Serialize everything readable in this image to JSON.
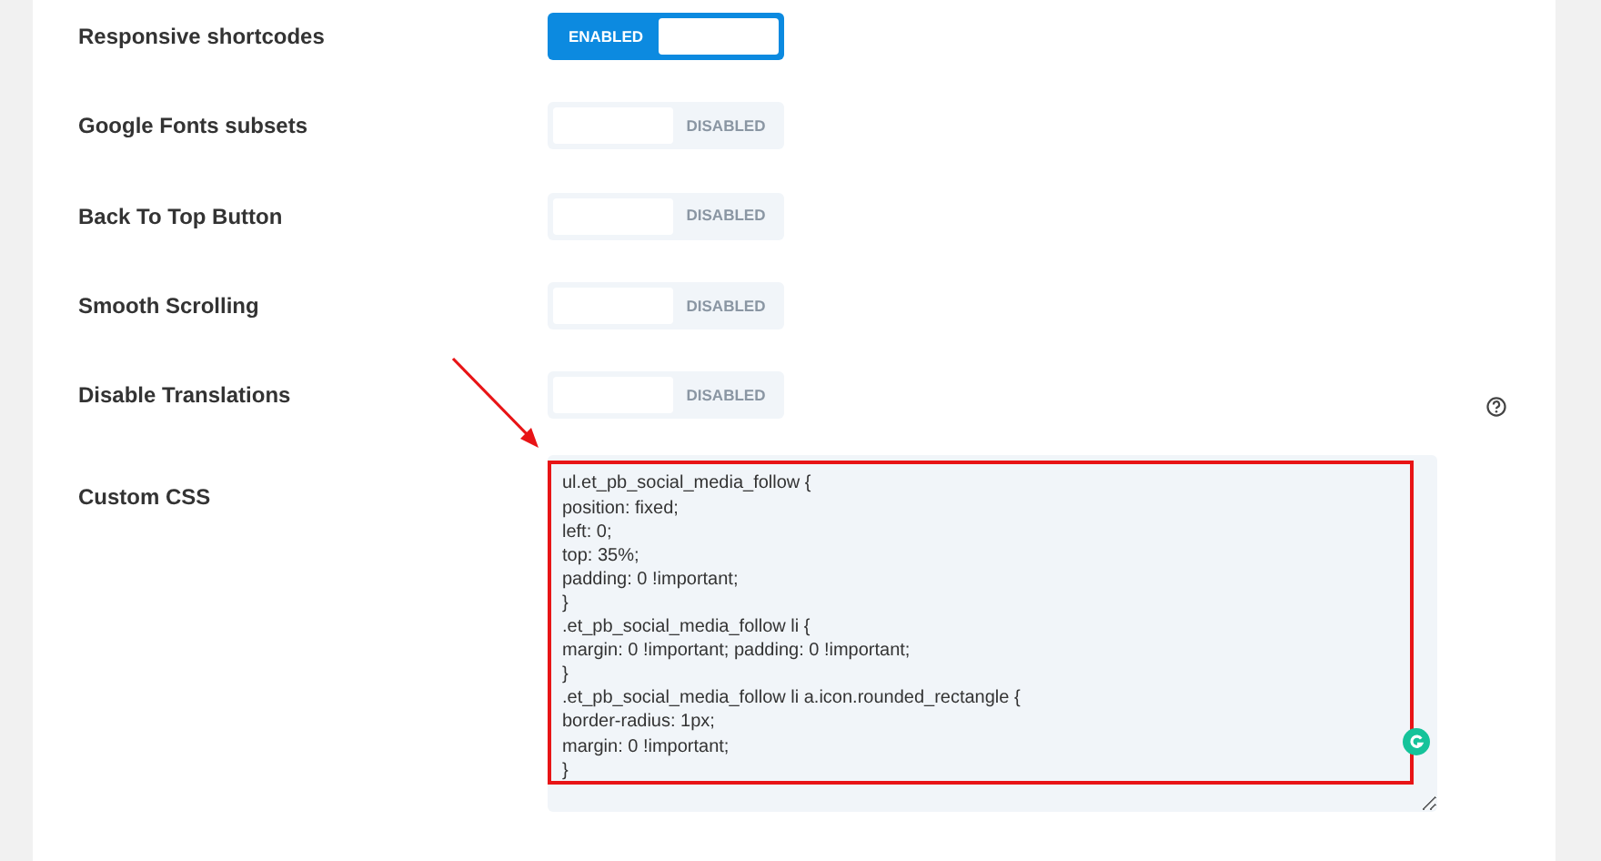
{
  "settings": [
    {
      "kind": "toggle",
      "label": "Responsive shortcodes",
      "on": true,
      "state_label": "ENABLED"
    },
    {
      "kind": "toggle",
      "label": "Google Fonts subsets",
      "on": false,
      "state_label": "DISABLED"
    },
    {
      "kind": "toggle",
      "label": "Back To Top Button",
      "on": false,
      "state_label": "DISABLED"
    },
    {
      "kind": "toggle",
      "label": "Smooth Scrolling",
      "on": false,
      "state_label": "DISABLED"
    },
    {
      "kind": "toggle",
      "label": "Disable Translations",
      "on": false,
      "state_label": "DISABLED",
      "help": true
    },
    {
      "kind": "code",
      "label": "Custom CSS",
      "value": "ul.et_pb_social_media_follow {\nposition: fixed;\nleft: 0;\ntop: 35%;\npadding: 0 !important;\n}\n.et_pb_social_media_follow li {\nmargin: 0 !important; padding: 0 !important;\n}\n.et_pb_social_media_follow li a.icon.rounded_rectangle {\nborder-radius: 1px;\nmargin: 0 !important;\n}",
      "highlighted": true
    }
  ]
}
